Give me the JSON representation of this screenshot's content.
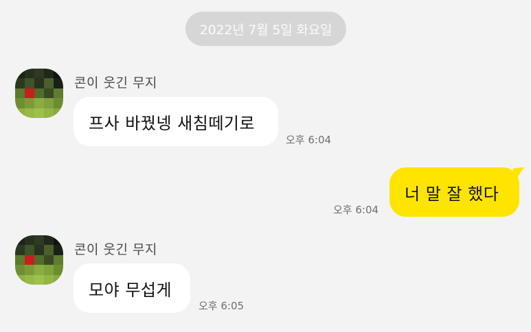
{
  "date_divider": "2022년 7월 5일 화요일",
  "colors": {
    "background": "#f3f3f3",
    "incoming_bubble": "#ffffff",
    "outgoing_bubble": "#fee500",
    "date_pill": "#d6d6d6"
  },
  "messages": [
    {
      "direction": "incoming",
      "sender": "콘이 웃긴 무지",
      "avatar": "pixelated-avatar-icon",
      "text": "프사 바꿨넹 새침떼기로",
      "time": "오후 6:04"
    },
    {
      "direction": "outgoing",
      "text": "너 말 잘 했다",
      "time": "오후 6:04"
    },
    {
      "direction": "incoming",
      "sender": "콘이 웃긴 무지",
      "avatar": "pixelated-avatar-icon",
      "text": "모야 무섭게",
      "time": "오후 6:05"
    }
  ]
}
